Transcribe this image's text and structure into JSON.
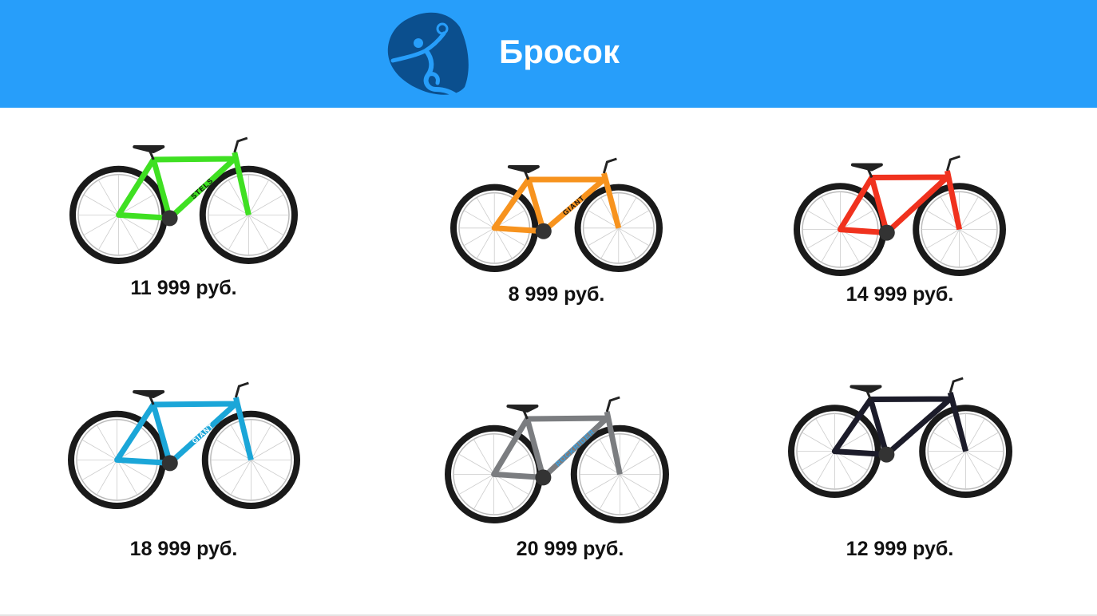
{
  "header": {
    "title": "Бросок",
    "logo_icon": "handball-player-logo",
    "bg_color": "#279efa",
    "logo_color": "#0b4f8e"
  },
  "products": [
    {
      "price": "11 999 руб.",
      "frame_color": "#3fe022",
      "brand": "STELS"
    },
    {
      "price": "8 999 руб.",
      "frame_color": "#f7931e",
      "brand": "GIANT"
    },
    {
      "price": "14 999 руб.",
      "frame_color": "#f0321e",
      "brand": ""
    },
    {
      "price": "18 999 руб.",
      "frame_color": "#1ba6d8",
      "brand": "GIANT"
    },
    {
      "price": "20 999 руб.",
      "frame_color": "#7b7d80",
      "brand": "ROCKRIDER"
    },
    {
      "price": "12 999 руб.",
      "frame_color": "#1c1c2a",
      "brand": ""
    }
  ]
}
